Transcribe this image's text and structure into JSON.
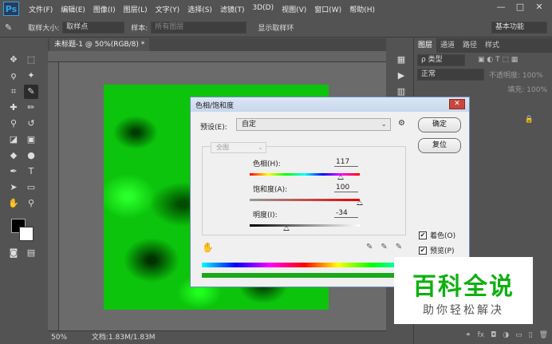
{
  "app": {
    "logo": "Ps"
  },
  "menu": [
    "文件(F)",
    "编辑(E)",
    "图像(I)",
    "图层(L)",
    "文字(Y)",
    "选择(S)",
    "滤镜(T)",
    "3D(D)",
    "视图(V)",
    "窗口(W)",
    "帮助(H)"
  ],
  "window_buttons": [
    "—",
    "□",
    "✕"
  ],
  "options": {
    "sample_size_label": "取样大小:",
    "sample_size_value": "取样点",
    "sample_label": "样本:",
    "sample_value": "所有图层",
    "show_ring": "显示取样环",
    "workspace": "基本功能"
  },
  "document": {
    "tab": "未标题-1 @ 50%(RGB/8) *",
    "zoom": "50%",
    "docsize": "文档:1.83M/1.83M"
  },
  "layers_panel": {
    "tabs": [
      "图层",
      "通道",
      "路径",
      "样式"
    ],
    "kind": "ρ 类型",
    "blend": "正常",
    "opacity_label": "不透明度: 100%",
    "fill_label": "填充: 100%"
  },
  "dialog": {
    "title": "色相/饱和度",
    "preset_label": "预设(E):",
    "preset_value": "自定",
    "ok": "确定",
    "reset": "复位",
    "channel": "全图",
    "hue_label": "色相(H):",
    "hue_value": "117",
    "sat_label": "饱和度(A):",
    "sat_value": "100",
    "light_label": "明度(I):",
    "light_value": "-34",
    "colorize": "着色(O)",
    "preview": "预览(P)",
    "colorize_checked": true,
    "preview_checked": true,
    "hue_level": 0.825,
    "sat_level": 1.0,
    "light_level": 0.33
  },
  "watermark": {
    "big": "百科全说",
    "small": "助你轻松解决"
  }
}
